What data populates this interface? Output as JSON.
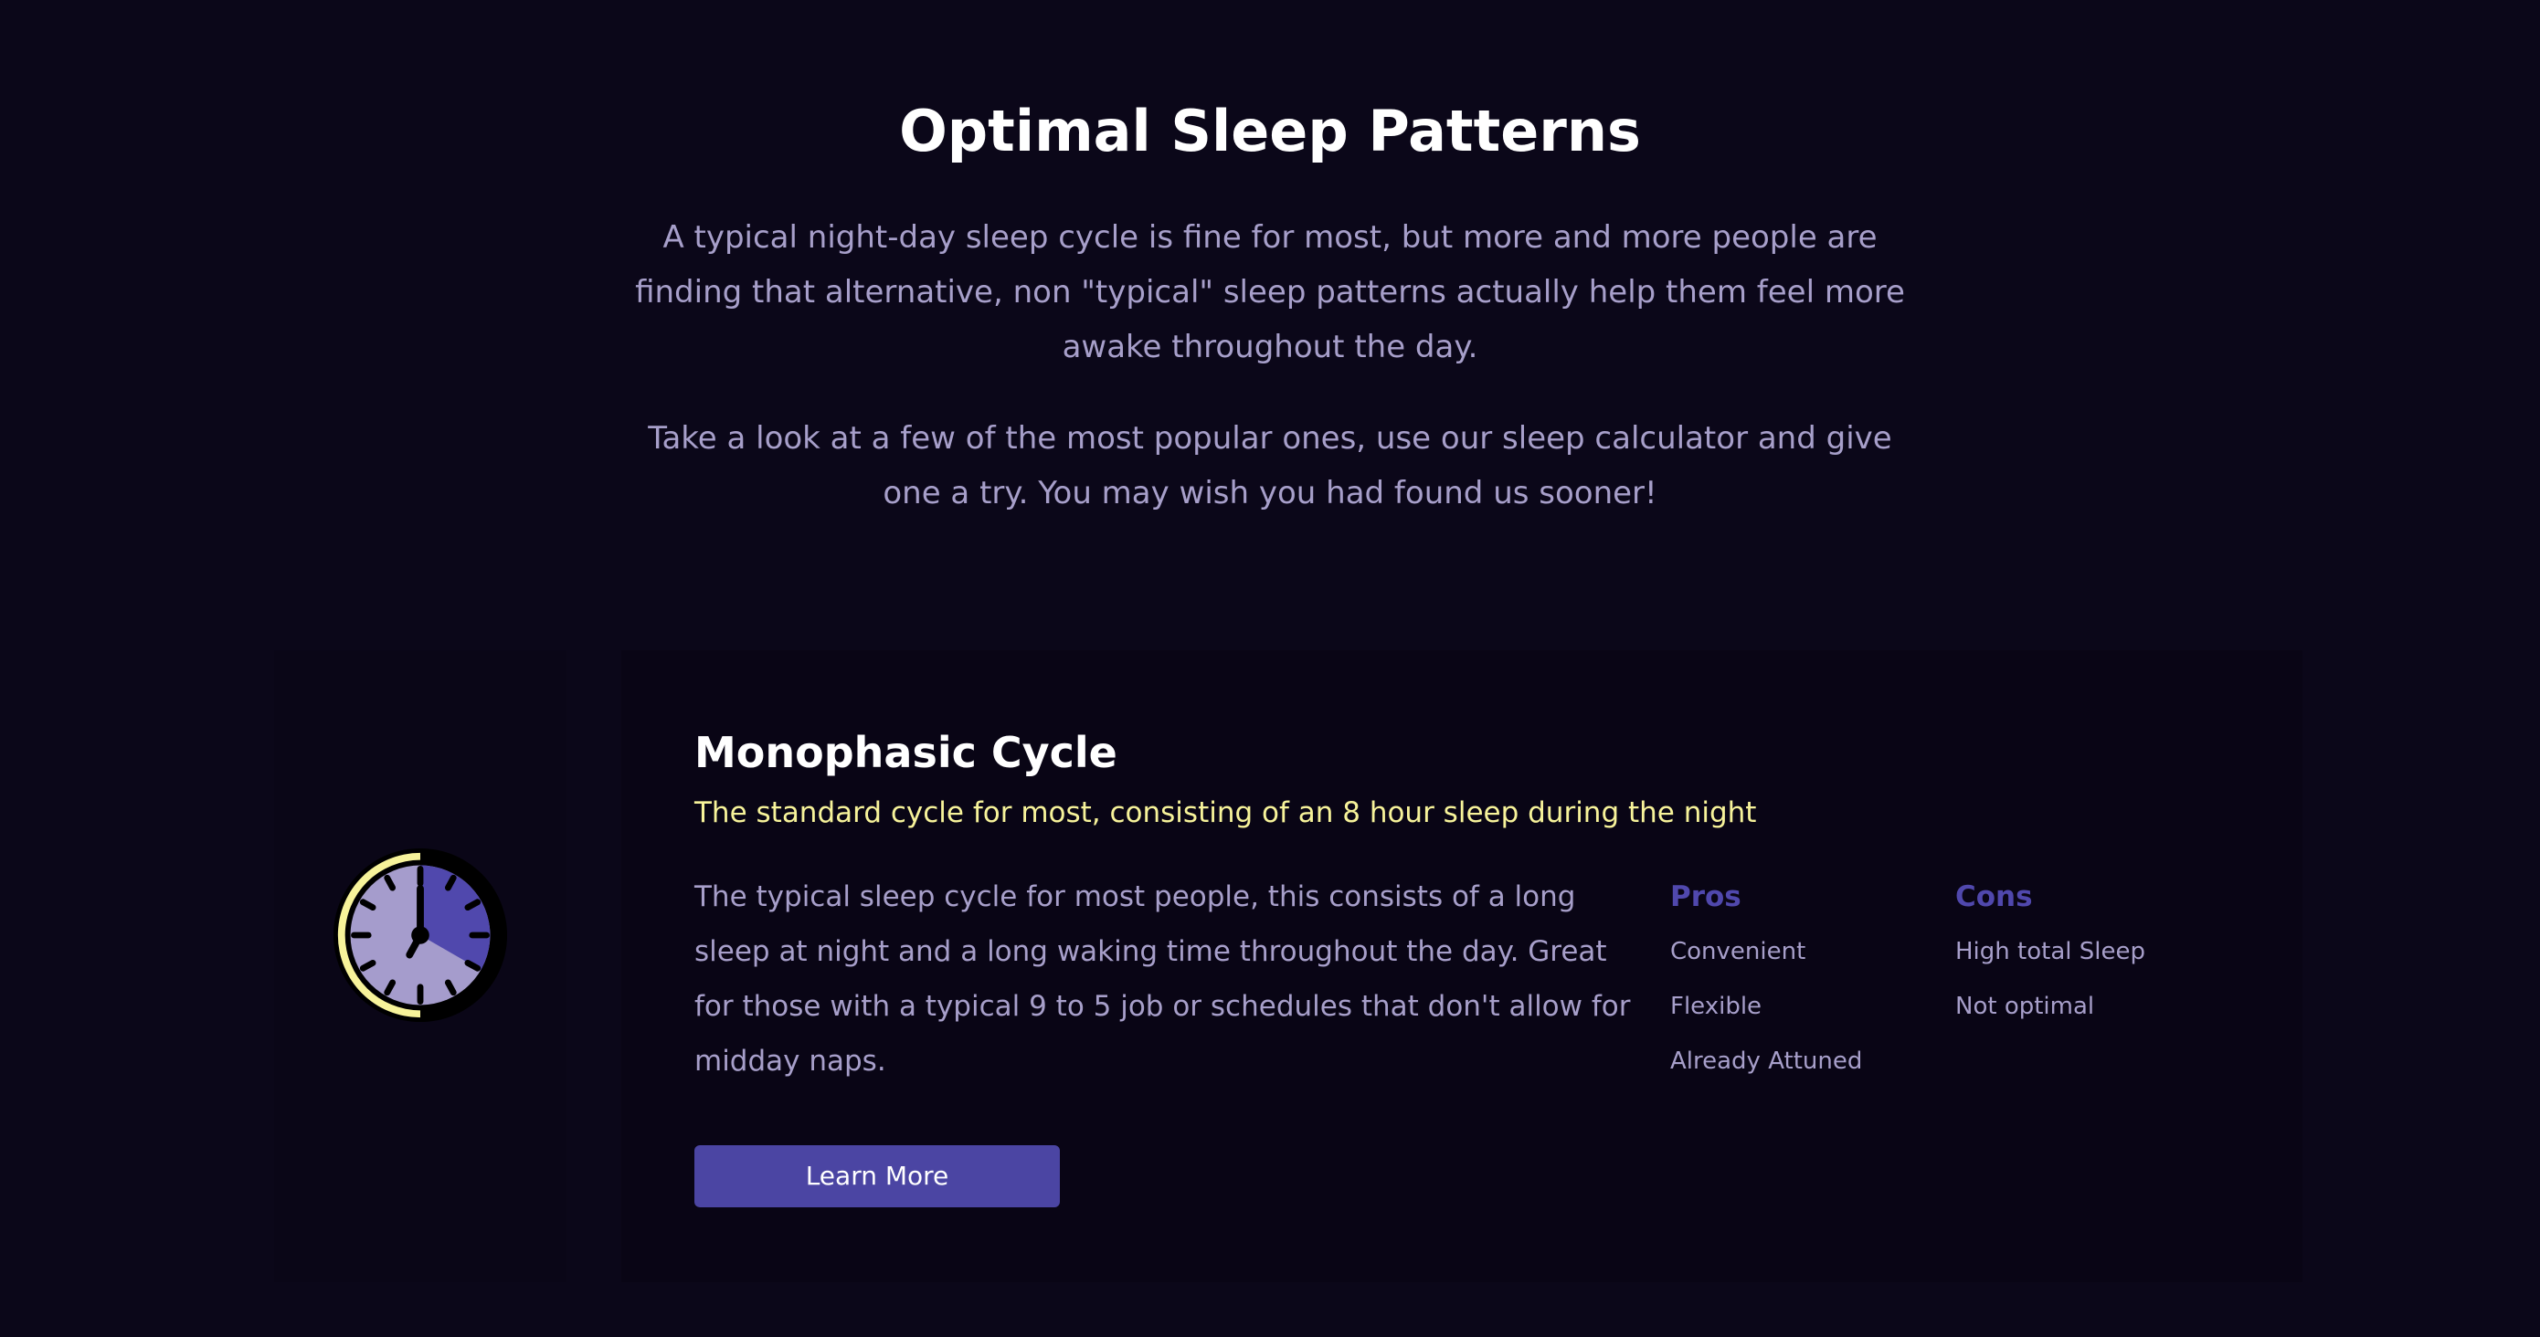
{
  "hero": {
    "title": "Optimal Sleep Patterns",
    "paragraph1": "A typical night-day sleep cycle is fine for most, but more and more people are finding that alternative, non \"typical\" sleep patterns actually help them feel more awake throughout the day.",
    "paragraph2": "Take a look at a few of the most popular ones, use our sleep calculator and give one a try. You may wish you had found us sooner!"
  },
  "card": {
    "icon": "clock-icon",
    "title": "Monophasic Cycle",
    "subtitle": "The standard cycle for most, consisting of an 8 hour sleep during the night",
    "description": "The typical sleep cycle for most people, this consists of a long sleep at night and a long waking time throughout the day. Great for those with a typical 9 to 5 job or schedules that don't allow for midday naps.",
    "button_label": "Learn More",
    "pros": {
      "heading": "Pros",
      "items": [
        "Convenient",
        "Flexible",
        "Already Attuned"
      ]
    },
    "cons": {
      "heading": "Cons",
      "items": [
        "High total Sleep",
        "Not optimal"
      ]
    }
  },
  "colors": {
    "background": "#0b0719",
    "card_background": "#090515",
    "accent": "#4b45a3",
    "highlight": "#f7f39a",
    "body_text": "#a79fca",
    "clock_face": "#a59ccc",
    "clock_sleep_segment": "#5048ad"
  }
}
